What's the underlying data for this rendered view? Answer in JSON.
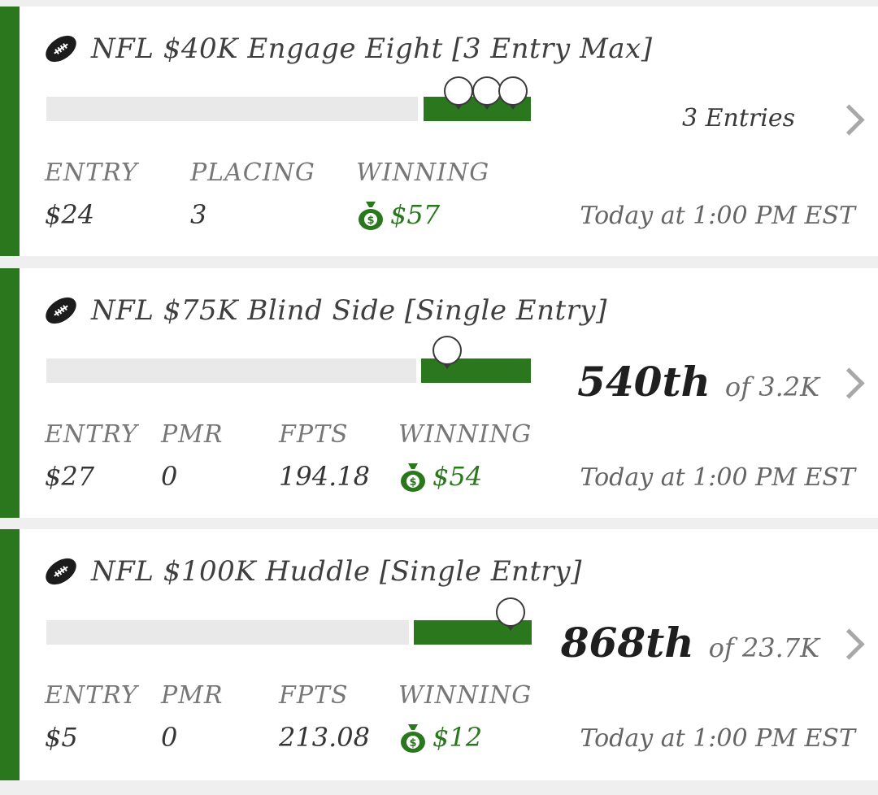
{
  "colors": {
    "accent_green": "#2a771e",
    "track_gray": "#e9e9e9",
    "background": "#efefef"
  },
  "icons": {
    "sport": "football-icon",
    "winnings": "money-bag-icon",
    "open": "chevron-right-icon"
  },
  "contests": [
    {
      "title": "NFL $40K Engage Eight [3 Entry Max]",
      "entries_label": "3 Entries",
      "progress_fraction": 0.88,
      "stats": [
        {
          "label": "ENTRY",
          "value": "$24"
        },
        {
          "label": "PLACING",
          "value": "3"
        },
        {
          "label": "WINNING",
          "value": "$57"
        }
      ],
      "start_time": "Today at 1:00 PM EST"
    },
    {
      "title": "NFL $75K Blind Side [Single Entry]",
      "rank": "540th",
      "field_size": "of 3.2K",
      "progress_fraction": 0.83,
      "stats": [
        {
          "label": "ENTRY",
          "value": "$27"
        },
        {
          "label": "PMR",
          "value": "0"
        },
        {
          "label": "FPTS",
          "value": "194.18"
        },
        {
          "label": "WINNING",
          "value": "$54"
        }
      ],
      "start_time": "Today at 1:00 PM EST"
    },
    {
      "title": "NFL $100K Huddle [Single Entry]",
      "rank": "868th",
      "field_size": "of 23.7K",
      "progress_fraction": 0.96,
      "stats": [
        {
          "label": "ENTRY",
          "value": "$5"
        },
        {
          "label": "PMR",
          "value": "0"
        },
        {
          "label": "FPTS",
          "value": "213.08"
        },
        {
          "label": "WINNING",
          "value": "$12"
        }
      ],
      "start_time": "Today at 1:00 PM EST"
    }
  ]
}
